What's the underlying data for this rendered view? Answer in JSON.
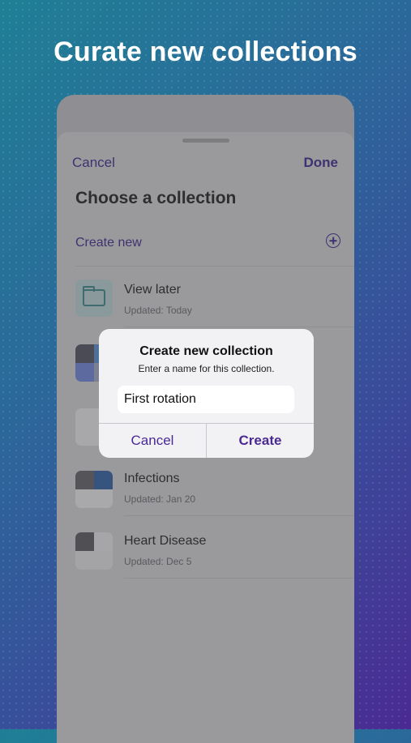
{
  "headline": "Curate new collections",
  "sheet": {
    "cancel_label": "Cancel",
    "done_label": "Done",
    "title": "Choose a collection",
    "create_new_label": "Create new",
    "collections": [
      {
        "name": "View later",
        "updated": "Updated: Today",
        "icon": "folder-icon"
      },
      {
        "name": "",
        "updated": ""
      },
      {
        "name": "",
        "updated": ""
      },
      {
        "name": "Infections",
        "updated": "Updated: Jan 20"
      },
      {
        "name": "Heart Disease",
        "updated": "Updated: Dec 5"
      }
    ]
  },
  "dialog": {
    "title": "Create new collection",
    "message": "Enter a name for this collection.",
    "input_value": "First rotation",
    "cancel_label": "Cancel",
    "create_label": "Create"
  },
  "colors": {
    "accent": "#4a2a92",
    "background_start": "#1f7f95",
    "background_end": "#4a2a92"
  }
}
